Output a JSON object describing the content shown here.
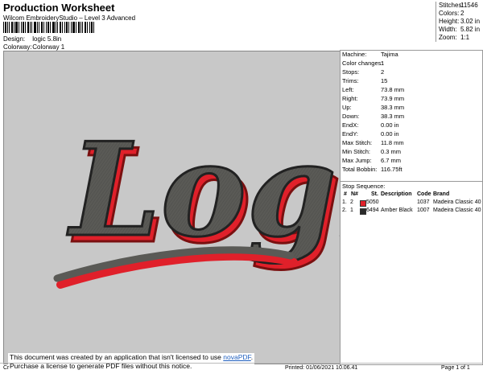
{
  "header": {
    "title": "Production Worksheet",
    "subtitle": "Wilcom EmbroideryStudio – Level 3 Advanced",
    "design_label": "Design:",
    "design_value": "logic 5.8in",
    "colorway_label": "Colorway:",
    "colorway_value": "Colorway 1"
  },
  "stats": [
    {
      "label": "Stitches:",
      "value": "11546"
    },
    {
      "label": "Colors:",
      "value": "2"
    },
    {
      "label": "Height:",
      "value": "3.02 in"
    },
    {
      "label": "Width:",
      "value": "5.82 in"
    },
    {
      "label": "Zoom:",
      "value": "1:1"
    }
  ],
  "machine_info": [
    {
      "label": "Machine:",
      "value": "Tajima"
    },
    {
      "label": "Color changes:",
      "value": "1"
    },
    {
      "label": "Stops:",
      "value": "2"
    },
    {
      "label": "Trims:",
      "value": "15"
    },
    {
      "label": "Left:",
      "value": "73.8 mm"
    },
    {
      "label": "Right:",
      "value": "73.9 mm"
    },
    {
      "label": "Up:",
      "value": "38.3 mm"
    },
    {
      "label": "Down:",
      "value": "38.3 mm"
    },
    {
      "label": "EndX:",
      "value": "0.00 in"
    },
    {
      "label": "EndY:",
      "value": "0.00 in"
    },
    {
      "label": "Max Stitch:",
      "value": "11.8 mm"
    },
    {
      "label": "Min Stitch:",
      "value": "0.3 mm"
    },
    {
      "label": "Max Jump:",
      "value": "6.7 mm"
    },
    {
      "label": "Total Bobbin:",
      "value": "116.75ft"
    }
  ],
  "stop_sequence": {
    "title": "Stop Sequence:",
    "columns": [
      "#",
      "N#",
      "St.",
      "Description",
      "Code",
      "Brand"
    ],
    "rows": [
      {
        "index": "1.",
        "needle": "2",
        "color": "#e0202a",
        "st": "5050",
        "description": "",
        "code": "1037",
        "brand": "Madeira Classic 40"
      },
      {
        "index": "2.",
        "needle": "1",
        "color": "#2b2b2b",
        "st": "6494",
        "description": "Amber Black",
        "code": "1007",
        "brand": "Madeira Classic 40"
      }
    ]
  },
  "design_preview": {
    "text": "Logic",
    "fill_color": "#5a5a56",
    "outline_color": "#e0202a",
    "background": "#c8c8c8"
  },
  "notice": {
    "line1_prefix": "This document was created by an application that isn't licensed to use ",
    "line1_link": "novaPDF",
    "line1_suffix": ".",
    "line2": "Purchase a license to generate PDF files without this notice."
  },
  "footer": {
    "left": "Cr",
    "printed": "Printed: 01/06/2021 10.06.41",
    "page": "Page 1 of 1"
  }
}
